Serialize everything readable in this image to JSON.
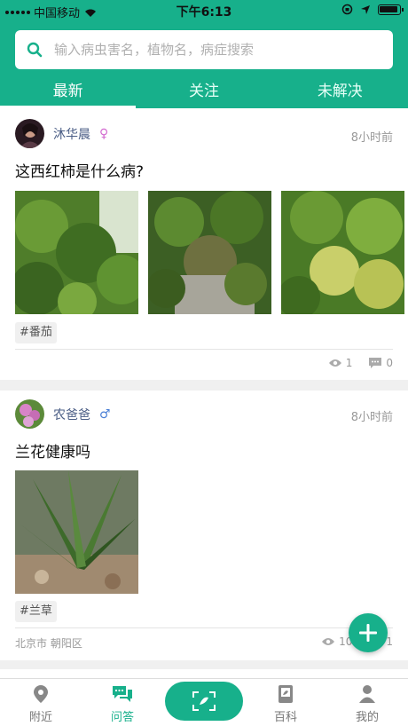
{
  "status": {
    "carrier": "中国移动",
    "time": "下午6:13"
  },
  "search": {
    "placeholder": "输入病虫害名，植物名，病症搜索"
  },
  "tabs": [
    {
      "label": "最新",
      "active": true
    },
    {
      "label": "关注",
      "active": false
    },
    {
      "label": "未解决",
      "active": false
    }
  ],
  "posts": [
    {
      "user": "沐华晨",
      "gender": "♀",
      "gender_color": "#d36bd0",
      "time": "8小时前",
      "title": "这西红柿是什么病?",
      "tag": "#番茄",
      "views": "1",
      "comments": "0"
    },
    {
      "user": "农爸爸",
      "gender": "♂",
      "gender_color": "#4a7fd6",
      "time": "8小时前",
      "title": "兰花健康吗",
      "tag": "#兰草",
      "location": "北京市 朝阳区",
      "views": "10",
      "comments": "1"
    }
  ],
  "nav": [
    {
      "label": "附近",
      "icon": "location-icon",
      "active": false
    },
    {
      "label": "问答",
      "icon": "chat-icon",
      "active": true
    },
    {
      "label": "",
      "icon": "scan-icon",
      "active": false
    },
    {
      "label": "百科",
      "icon": "book-icon",
      "active": false
    },
    {
      "label": "我的",
      "icon": "user-icon",
      "active": false
    }
  ],
  "colors": {
    "brand": "#17b08b"
  }
}
